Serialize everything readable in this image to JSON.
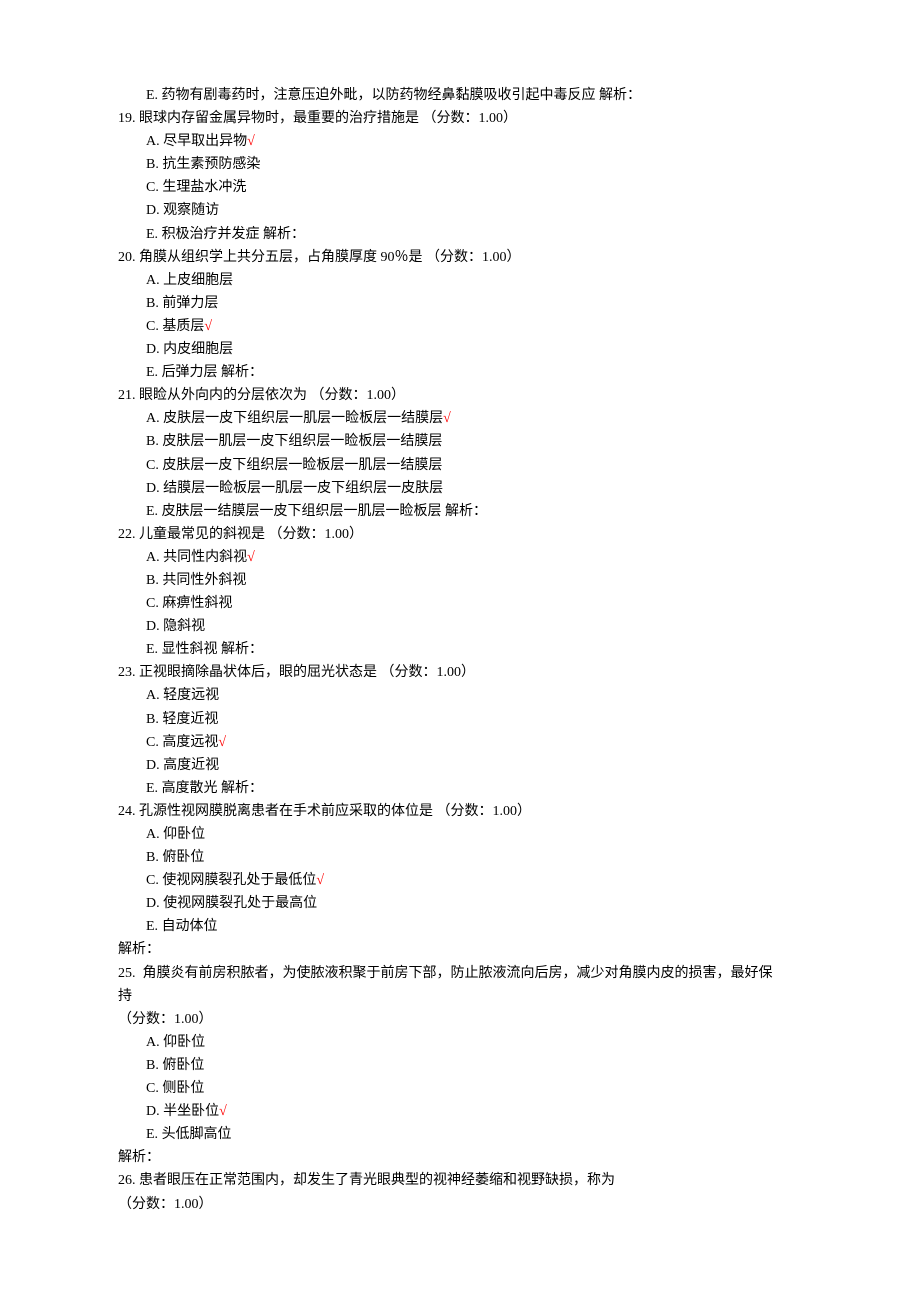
{
  "leadingE": "E. 药物有剧毒药时，注意压迫外毗，以防药物经鼻黏膜吸收引起中毒反应 解析：",
  "questions": [
    {
      "num": "19.",
      "text": "眼球内存留金属异物时，最重要的治疗措施是 （分数：1.00）",
      "options": [
        {
          "label": "A.",
          "text": "尽早取出异物",
          "mark": true
        },
        {
          "label": "B.",
          "text": "抗生素预防感染"
        },
        {
          "label": "C.",
          "text": "生理盐水冲洗"
        },
        {
          "label": "D.",
          "text": "观察随访"
        },
        {
          "label": "E.",
          "text": "积极治疗并发症 解析："
        }
      ]
    },
    {
      "num": "20.",
      "text": "角膜从组织学上共分五层，占角膜厚度 90％是 （分数：1.00）",
      "options": [
        {
          "label": "A.",
          "text": "上皮细胞层"
        },
        {
          "label": "B.",
          "text": "前弹力层"
        },
        {
          "label": "C.",
          "text": "基质层",
          "mark": true
        },
        {
          "label": "D.",
          "text": "内皮细胞层"
        },
        {
          "label": "E.",
          "text": "后弹力层 解析："
        }
      ]
    },
    {
      "num": "21.",
      "text": "眼睑从外向内的分层依次为 （分数：1.00）",
      "options": [
        {
          "label": "A.",
          "text": "皮肤层一皮下组织层一肌层一睑板层一结膜层",
          "mark": true
        },
        {
          "label": "B.",
          "text": "皮肤层一肌层一皮下组织层一睑板层一结膜层"
        },
        {
          "label": "C.",
          "text": "皮肤层一皮下组织层一睑板层一肌层一结膜层"
        },
        {
          "label": "D.",
          "text": "结膜层一睑板层一肌层一皮下组织层一皮肤层"
        },
        {
          "label": "E.",
          "text": "皮肤层一结膜层一皮下组织层一肌层一睑板层 解析："
        }
      ]
    },
    {
      "num": "22.",
      "text": "儿童最常见的斜视是 （分数：1.00）",
      "options": [
        {
          "label": "A.",
          "text": "共同性内斜视",
          "mark": true
        },
        {
          "label": "B.",
          "text": "共同性外斜视"
        },
        {
          "label": "C.",
          "text": "麻痹性斜视"
        },
        {
          "label": "D.",
          "text": "隐斜视"
        },
        {
          "label": "E.",
          "text": "显性斜视 解析："
        }
      ]
    },
    {
      "num": "23.",
      "text": "正视眼摘除晶状体后，眼的屈光状态是 （分数：1.00）",
      "options": [
        {
          "label": "A.",
          "text": "轻度远视"
        },
        {
          "label": "B.",
          "text": "轻度近视"
        },
        {
          "label": "C.",
          "text": "高度远视",
          "mark": true
        },
        {
          "label": "D.",
          "text": "高度近视"
        },
        {
          "label": "E.",
          "text": "高度散光 解析："
        }
      ]
    },
    {
      "num": "24.",
      "text": "孔源性视网膜脱离患者在手术前应采取的体位是 （分数：1.00）",
      "options": [
        {
          "label": "A.",
          "text": "仰卧位"
        },
        {
          "label": "B.",
          "text": "俯卧位"
        },
        {
          "label": "C.",
          "text": "使视网膜裂孔处于最低位",
          "mark": true
        },
        {
          "label": "D.",
          "text": "使视网膜裂孔处于最高位"
        },
        {
          "label": "E.",
          "text": "自动体位"
        }
      ],
      "postLines": [
        "解析："
      ]
    },
    {
      "num": "25.",
      "sep": "  ",
      "text": "角膜炎有前房积脓者，为使脓液积聚于前房下部，防止脓液流向后房，减少对角膜内皮的损害，最好保",
      "extraLines": [
        "持",
        "（分数：1.00）"
      ],
      "options": [
        {
          "label": "A.",
          "text": "仰卧位"
        },
        {
          "label": "B.",
          "text": "俯卧位"
        },
        {
          "label": "C.",
          "text": "侧卧位"
        },
        {
          "label": "D.",
          "text": "半坐卧位",
          "mark": true
        },
        {
          "label": "E.",
          "text": "头低脚高位"
        }
      ],
      "postLines": [
        "解析："
      ]
    },
    {
      "num": "26.",
      "text": "患者眼压在正常范围内，却发生了青光眼典型的视神经萎缩和视野缺损，称为",
      "extraLines": [
        "（分数：1.00）"
      ],
      "options": []
    }
  ],
  "mark": "√"
}
